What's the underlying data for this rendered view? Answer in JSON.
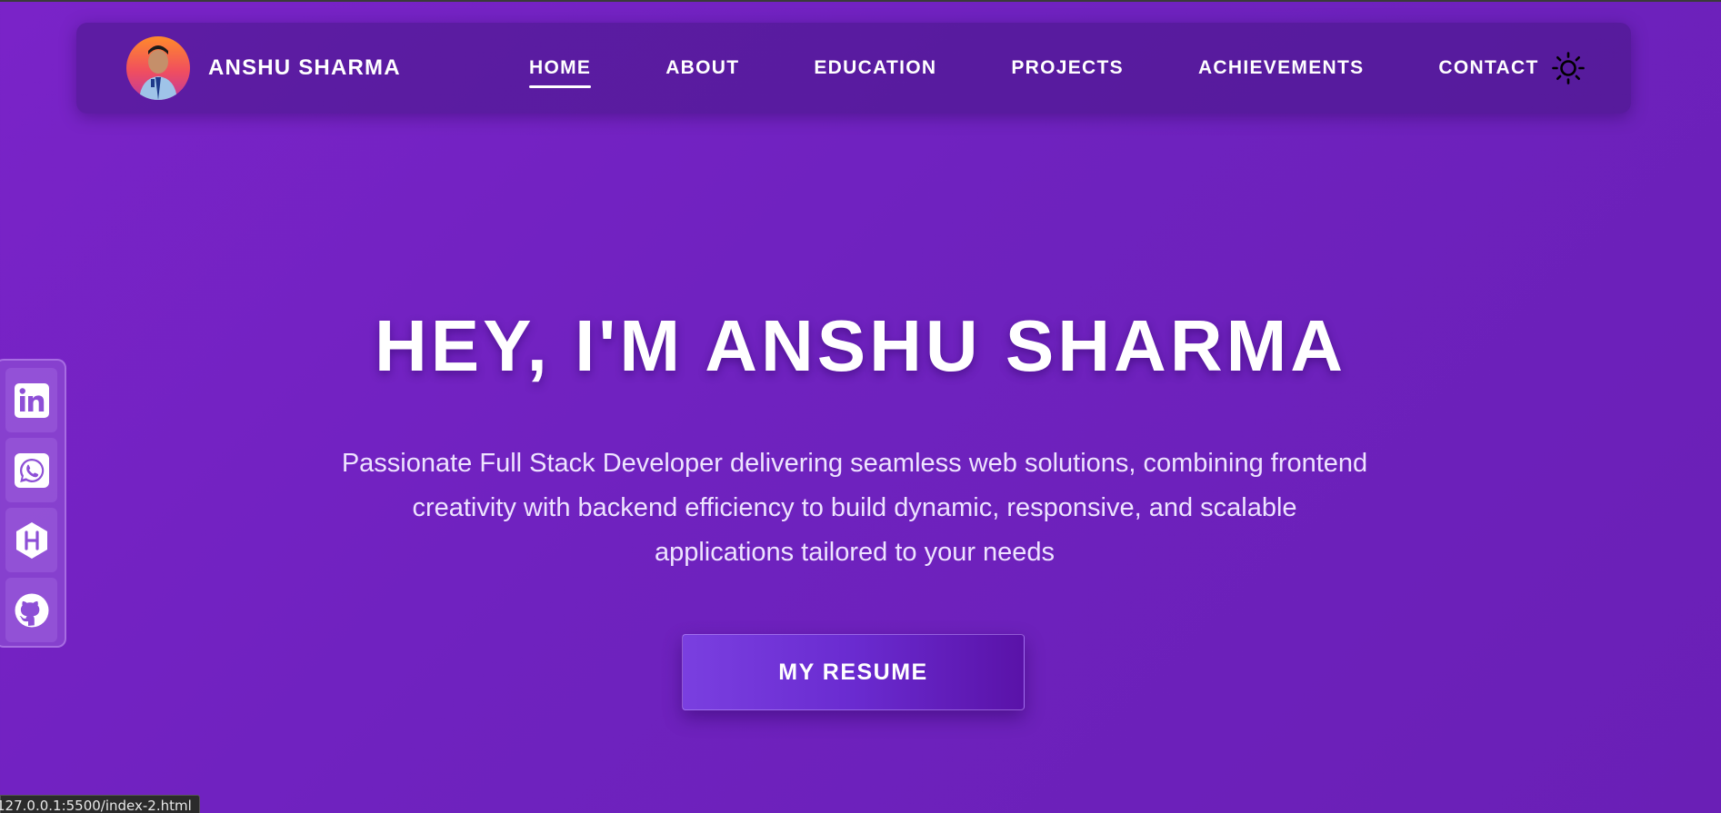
{
  "nav": {
    "brand_name": "ANSHU SHARMA",
    "links": [
      {
        "label": "HOME",
        "active": true
      },
      {
        "label": "ABOUT",
        "active": false
      },
      {
        "label": "EDUCATION",
        "active": false
      },
      {
        "label": "PROJECTS",
        "active": false
      },
      {
        "label": "ACHIEVEMENTS",
        "active": false
      },
      {
        "label": "CONTACT",
        "active": false
      }
    ],
    "theme_toggle_icon": "sun-icon"
  },
  "social": [
    {
      "icon": "linkedin-icon"
    },
    {
      "icon": "whatsapp-icon"
    },
    {
      "icon": "hackerrank-icon"
    },
    {
      "icon": "github-icon"
    }
  ],
  "hero": {
    "title": "HEY, I'M ANSHU SHARMA",
    "description": "Passionate Full Stack Developer delivering seamless web solutions, combining frontend creativity with backend efficiency to build dynamic, responsive, and scalable applications tailored to your needs",
    "resume_button": "MY RESUME"
  },
  "status_bar": {
    "url": "127.0.0.1:5500/index-2.html"
  },
  "colors": {
    "background": "#7122c0",
    "navbar": "#5a1d9c",
    "accent_button": "#6a2bd0",
    "text": "#ffffff"
  }
}
